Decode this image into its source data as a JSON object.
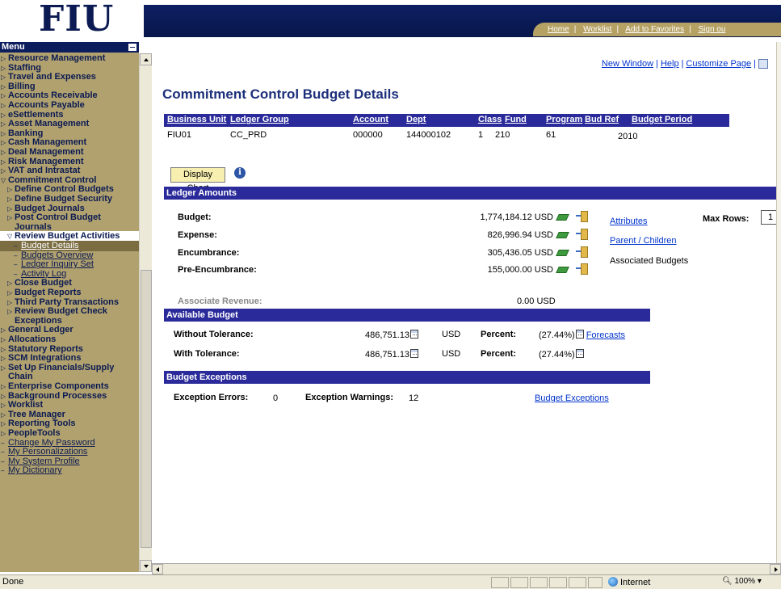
{
  "brand": {
    "logo_text": "FIU"
  },
  "header_nav": [
    "Home",
    "Worklist",
    "Add to Favorites",
    "Sign ou"
  ],
  "sidebar": {
    "title": "Menu",
    "items": [
      {
        "label": "Resource Management",
        "type": "folder"
      },
      {
        "label": "Staffing",
        "type": "folder"
      },
      {
        "label": "Travel and Expenses",
        "type": "folder"
      },
      {
        "label": "Billing",
        "type": "folder"
      },
      {
        "label": "Accounts Receivable",
        "type": "folder"
      },
      {
        "label": "Accounts Payable",
        "type": "folder"
      },
      {
        "label": "eSettlements",
        "type": "folder"
      },
      {
        "label": "Asset Management",
        "type": "folder"
      },
      {
        "label": "Banking",
        "type": "folder"
      },
      {
        "label": "Cash Management",
        "type": "folder"
      },
      {
        "label": "Deal Management",
        "type": "folder"
      },
      {
        "label": "Risk Management",
        "type": "folder"
      },
      {
        "label": "VAT and Intrastat",
        "type": "folder"
      },
      {
        "label": "Commitment Control",
        "type": "open"
      },
      {
        "label": "Define Control Budgets",
        "type": "sub"
      },
      {
        "label": "Define Budget Security",
        "type": "sub"
      },
      {
        "label": "Budget Journals",
        "type": "sub"
      },
      {
        "label": "Post Control Budget",
        "type": "sub"
      },
      {
        "label": "Journals",
        "type": "sub-cont"
      },
      {
        "label": "Review Budget Activities",
        "type": "sub-open"
      },
      {
        "label": "Budget Details",
        "type": "current"
      },
      {
        "label": "Budgets Overview",
        "type": "leaf"
      },
      {
        "label": "Ledger Inquiry Set",
        "type": "leaf"
      },
      {
        "label": "Activity Log",
        "type": "leaf"
      },
      {
        "label": "Close Budget",
        "type": "sub"
      },
      {
        "label": "Budget Reports",
        "type": "sub"
      },
      {
        "label": "Third Party Transactions",
        "type": "sub"
      },
      {
        "label": "Review Budget Check",
        "type": "sub"
      },
      {
        "label": "Exceptions",
        "type": "sub-cont"
      },
      {
        "label": "General Ledger",
        "type": "folder"
      },
      {
        "label": "Allocations",
        "type": "folder"
      },
      {
        "label": "Statutory Reports",
        "type": "folder"
      },
      {
        "label": "SCM Integrations",
        "type": "folder"
      },
      {
        "label": "Set Up Financials/Supply",
        "type": "folder"
      },
      {
        "label": "Chain",
        "type": "folder-cont"
      },
      {
        "label": "Enterprise Components",
        "type": "folder"
      },
      {
        "label": "Background Processes",
        "type": "folder"
      },
      {
        "label": "Worklist",
        "type": "folder"
      },
      {
        "label": "Tree Manager",
        "type": "folder"
      },
      {
        "label": "Reporting Tools",
        "type": "folder"
      },
      {
        "label": "PeopleTools",
        "type": "folder"
      },
      {
        "label": "Change My Password",
        "type": "toplink"
      },
      {
        "label": "My Personalizations",
        "type": "toplink"
      },
      {
        "label": "My System Profile",
        "type": "toplink"
      },
      {
        "label": "My Dictionary",
        "type": "toplink"
      }
    ]
  },
  "toplinks": {
    "new_window": "New Window",
    "help": "Help",
    "customize": "Customize Page"
  },
  "page_title": "Commitment Control Budget Details",
  "keys": {
    "headers": [
      "Business Unit",
      "Ledger Group",
      "Account",
      "Dept",
      "Class",
      "Fund",
      "Program",
      "Bud Ref",
      "Budget Period"
    ],
    "values": [
      "FIU01",
      "CC_PRD",
      "000000",
      "144000102",
      "1",
      "210",
      "61",
      "",
      "2010"
    ]
  },
  "display_chart": "Display Chart",
  "ledger": {
    "section_title": "Ledger Amounts",
    "rows": [
      {
        "label": "Budget:",
        "amount": "1,774,184.12 USD"
      },
      {
        "label": "Expense:",
        "amount": "826,996.94 USD"
      },
      {
        "label": "Encumbrance:",
        "amount": "305,436.05 USD"
      },
      {
        "label": "Pre-Encumbrance:",
        "amount": "155,000.00 USD"
      }
    ],
    "attributes": "Attributes",
    "parent_children": "Parent / Children",
    "associated": "Associated Budgets",
    "max_rows_label": "Max Rows:",
    "max_rows_value": "1",
    "associate_revenue_label": "Associate Revenue:",
    "associate_revenue_amount": "0.00 USD"
  },
  "available": {
    "section_title": "Available Budget",
    "rows": [
      {
        "label": "Without Tolerance:",
        "amount": "486,751.13",
        "currency": "USD",
        "percent_label": "Percent:",
        "percent": "(27.44%)"
      },
      {
        "label": "With Tolerance:",
        "amount": "486,751.13",
        "currency": "USD",
        "percent_label": "Percent:",
        "percent": "(27.44%)"
      }
    ],
    "forecasts": "Forecasts"
  },
  "exceptions": {
    "section_title": "Budget Exceptions",
    "errors_label": "Exception Errors:",
    "errors": "0",
    "warnings_label": "Exception Warnings:",
    "warnings": "12",
    "link": "Budget Exceptions"
  },
  "status": {
    "text": "Done",
    "zone": "Internet",
    "zoom": "100%"
  }
}
